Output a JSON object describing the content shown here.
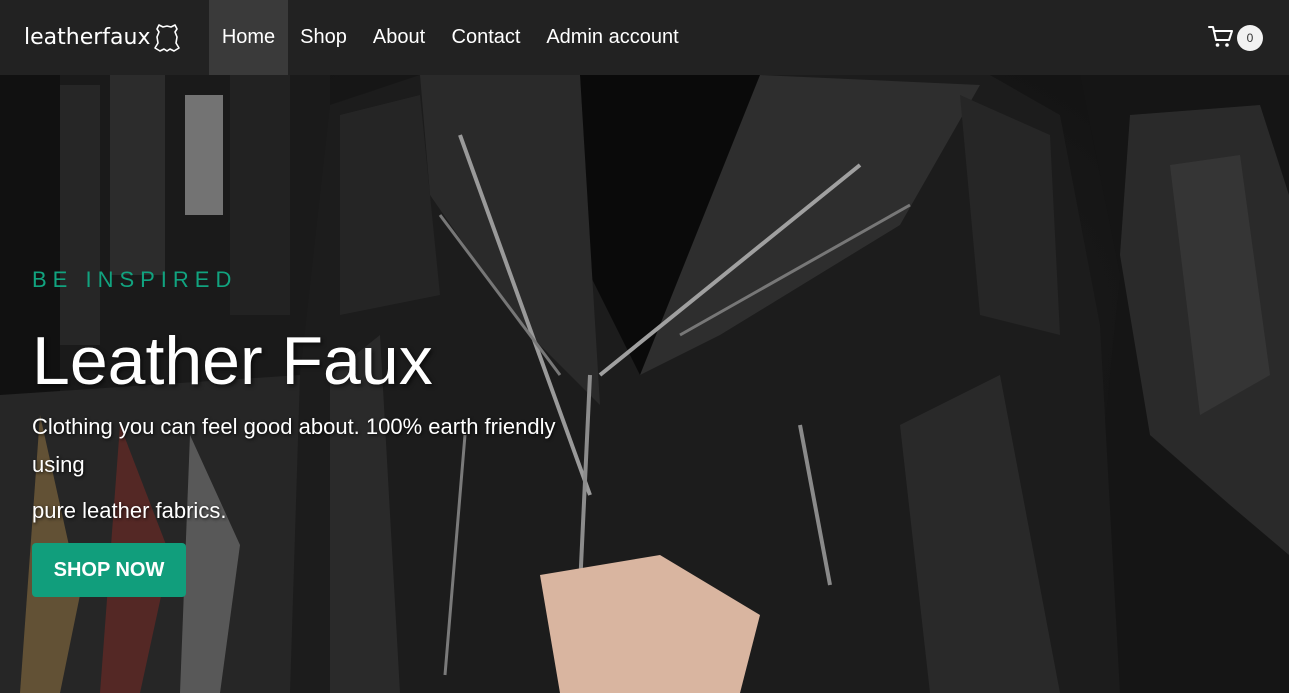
{
  "navbar": {
    "brand": "leatherfaux",
    "items": [
      {
        "label": "Home",
        "active": true
      },
      {
        "label": "Shop"
      },
      {
        "label": "About"
      },
      {
        "label": "Contact"
      },
      {
        "label": "Admin account"
      }
    ],
    "cart": {
      "icon": "cart-icon",
      "count": "0"
    }
  },
  "hero": {
    "eyebrow": "BE INSPIRED",
    "title": "Leather Faux",
    "subtitle_line1": "Clothing you can feel good about. 100% earth friendly using",
    "subtitle_line2": "pure leather fabrics.",
    "cta": "SHOP NOW"
  },
  "colors": {
    "navbar_bg": "#222222",
    "active_nav_bg": "#3a3a3a",
    "accent": "#119e7c"
  }
}
